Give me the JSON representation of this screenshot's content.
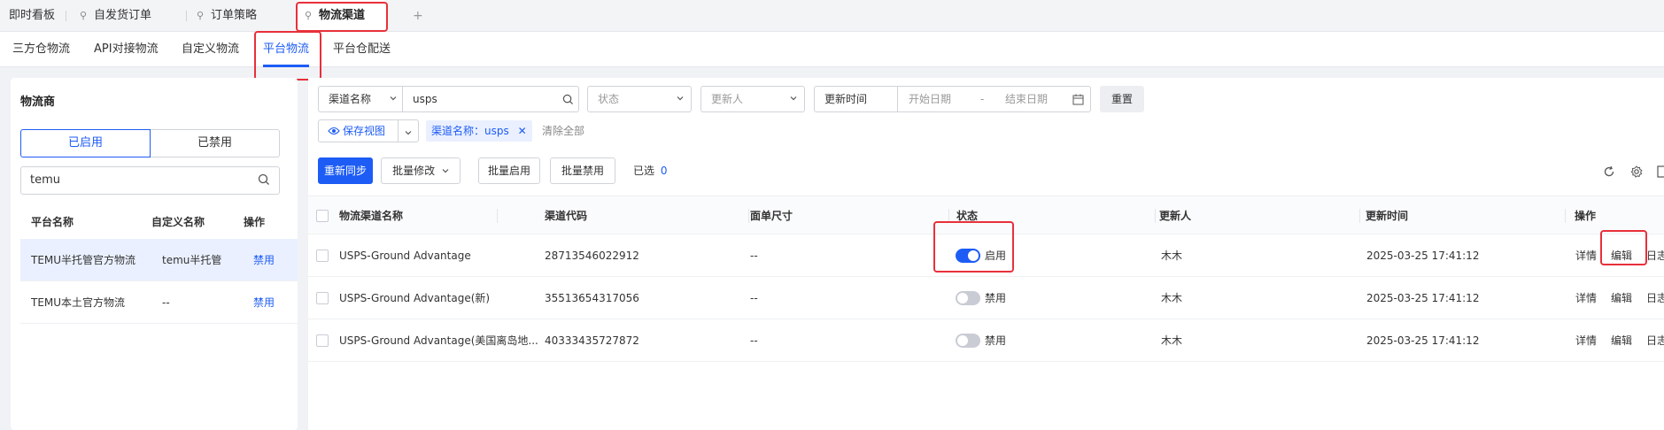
{
  "top_tabs": [
    {
      "label": "即时看板",
      "pinned": false
    },
    {
      "label": "自发货订单",
      "pinned": true
    },
    {
      "label": "订单策略",
      "pinned": true
    },
    {
      "label": "物流渠道",
      "pinned": true,
      "active": true
    }
  ],
  "top_plus": "+",
  "sub_tabs": [
    {
      "label": "三方仓物流"
    },
    {
      "label": "API对接物流"
    },
    {
      "label": "自定义物流"
    },
    {
      "label": "平台物流",
      "active": true
    },
    {
      "label": "平台仓配送"
    }
  ],
  "left": {
    "title": "物流商",
    "seg_on": "已启用",
    "seg_off": "已禁用",
    "search_value": "temu",
    "headers": {
      "platform": "平台名称",
      "custom": "自定义名称",
      "op": "操作"
    },
    "rows": [
      {
        "platform": "TEMU半托管官方物流",
        "custom": "temu半托管",
        "op": "禁用",
        "selected": true
      },
      {
        "platform": "TEMU本土官方物流",
        "custom": "--",
        "op": "禁用",
        "selected": false
      }
    ]
  },
  "filters": {
    "channel_name_select": "渠道名称",
    "channel_name_value": "usps",
    "status_placeholder": "状态",
    "updater_placeholder": "更新人",
    "update_time_label": "更新时间",
    "start_placeholder": "开始日期",
    "range_sep": "-",
    "end_placeholder": "结束日期",
    "reset": "重置",
    "save_view": "保存视图",
    "active_tag": "渠道名称：usps",
    "clear_all": "清除全部"
  },
  "toolbar": {
    "resync": "重新同步",
    "batch_edit": "批量修改",
    "batch_enable": "批量启用",
    "batch_disable": "批量禁用",
    "selected_label": "已选",
    "selected_count": "0"
  },
  "table": {
    "headers": {
      "name": "物流渠道名称",
      "code": "渠道代码",
      "size": "面单尺寸",
      "status": "状态",
      "updater": "更新人",
      "time": "更新时间",
      "op": "操作"
    },
    "rows": [
      {
        "name": "USPS-Ground Advantage",
        "code": "28713546022912",
        "size": "--",
        "status_on": true,
        "status": "启用",
        "updater": "木木",
        "time": "2025-03-25 17:41:12",
        "detail": "详情",
        "edit": "编辑",
        "log": "日志"
      },
      {
        "name": "USPS-Ground Advantage(新)",
        "code": "35513654317056",
        "size": "--",
        "status_on": false,
        "status": "禁用",
        "updater": "木木",
        "time": "2025-03-25 17:41:12",
        "detail": "详情",
        "edit": "编辑",
        "log": "日志"
      },
      {
        "name": "USPS-Ground Advantage(美国离岛地...",
        "code": "40333435727872",
        "size": "--",
        "status_on": false,
        "status": "禁用",
        "updater": "木木",
        "time": "2025-03-25 17:41:12",
        "detail": "详情",
        "edit": "编辑",
        "log": "日志"
      }
    ]
  },
  "colors": {
    "primary": "#1d5cf5",
    "highlight": "#e8303a"
  }
}
